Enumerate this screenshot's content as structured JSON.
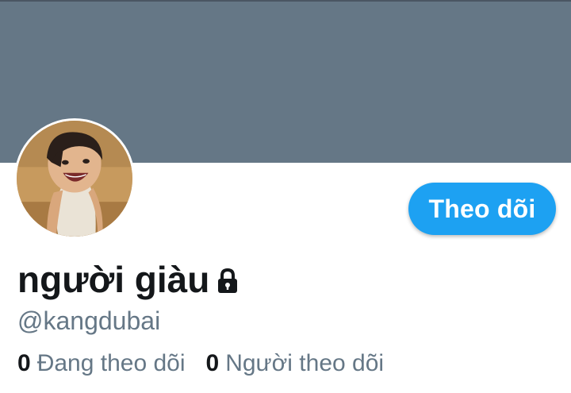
{
  "colors": {
    "banner": "#657786",
    "accent": "#1da1f2",
    "text_primary": "#14171a",
    "text_secondary": "#657786"
  },
  "profile": {
    "display_name": "người giàu",
    "protected_icon": "lock-icon",
    "handle": "@kangdubai",
    "avatar_icon": "avatar-photo"
  },
  "actions": {
    "follow_label": "Theo dõi"
  },
  "stats": {
    "following_count": "0",
    "following_label": "Đang theo dõi",
    "followers_count": "0",
    "followers_label": "Người theo dõi"
  }
}
